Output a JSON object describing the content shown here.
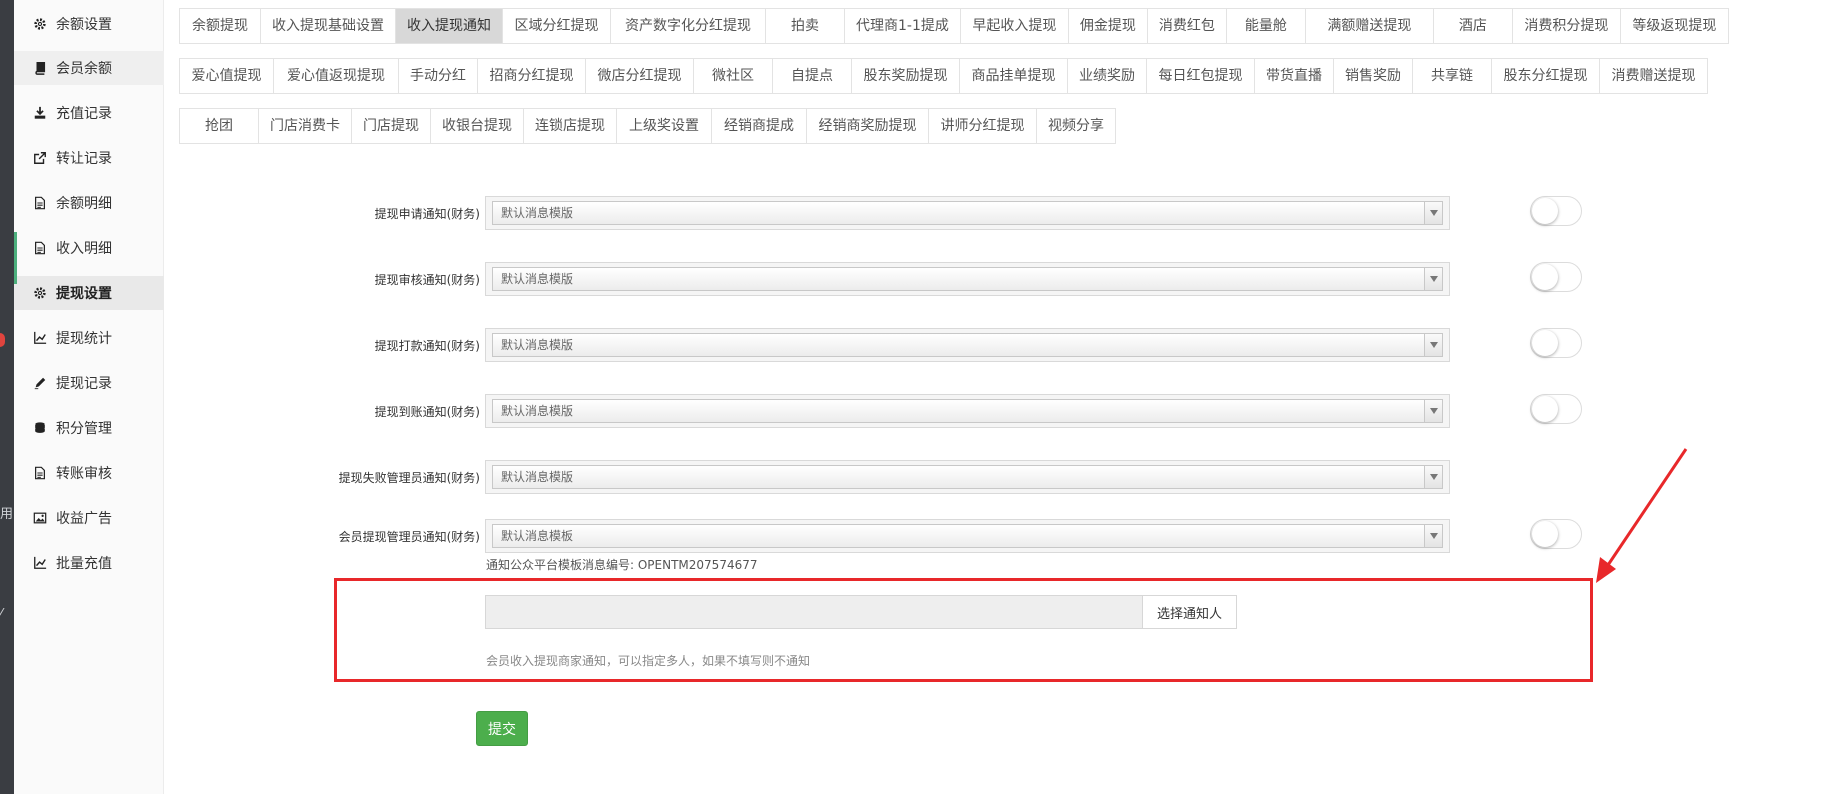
{
  "sidebar": {
    "items": [
      {
        "label": "余额设置",
        "icon": "gear-icon"
      },
      {
        "label": "会员余额",
        "icon": "book-icon"
      },
      {
        "label": "充值记录",
        "icon": "download-icon"
      },
      {
        "label": "转让记录",
        "icon": "external-link-icon"
      },
      {
        "label": "余额明细",
        "icon": "document-icon"
      },
      {
        "label": "收入明细",
        "icon": "document-icon"
      },
      {
        "label": "提现设置",
        "icon": "gear-icon"
      },
      {
        "label": "提现统计",
        "icon": "line-chart-icon"
      },
      {
        "label": "提现记录",
        "icon": "pencil-icon"
      },
      {
        "label": "积分管理",
        "icon": "database-icon"
      },
      {
        "label": "转账审核",
        "icon": "document-icon"
      },
      {
        "label": "收益广告",
        "icon": "image-icon"
      },
      {
        "label": "批量充值",
        "icon": "line-chart-icon"
      }
    ],
    "active_index": 6
  },
  "left_strip": {
    "glyph_1": "用",
    "glyph_2": "⁄"
  },
  "tabs": {
    "row1": [
      "余额提现",
      "收入提现基础设置",
      "收入提现通知",
      "区域分红提现",
      "资产数字化分红提现",
      "拍卖",
      "代理商1-1提成",
      "早起收入提现",
      "佣金提现",
      "消费红包",
      "能量舱",
      "满额赠送提现",
      "酒店",
      "消费积分提现",
      "等级返现提现"
    ],
    "row2": [
      "爱心值提现",
      "爱心值返现提现",
      "手动分红",
      "招商分红提现",
      "微店分红提现",
      "微社区",
      "自提点",
      "股东奖励提现",
      "商品挂单提现",
      "业绩奖励",
      "每日红包提现",
      "带货直播",
      "销售奖励",
      "共享链",
      "股东分红提现",
      "消费赠送提现"
    ],
    "row3": [
      "抢团",
      "门店消费卡",
      "门店提现",
      "收银台提现",
      "连锁店提现",
      "上级奖设置",
      "经销商提成",
      "经销商奖励提现",
      "讲师分红提现",
      "视频分享"
    ],
    "active": "收入提现通知"
  },
  "form": {
    "rows": [
      {
        "label": "提现申请通知(财务)",
        "select_value": "默认消息模版",
        "has_toggle": true,
        "toggle_on": false
      },
      {
        "label": "提现审核通知(财务)",
        "select_value": "默认消息模版",
        "has_toggle": true,
        "toggle_on": false
      },
      {
        "label": "提现打款通知(财务)",
        "select_value": "默认消息模版",
        "has_toggle": true,
        "toggle_on": false
      },
      {
        "label": "提现到账通知(财务)",
        "select_value": "默认消息模版",
        "has_toggle": true,
        "toggle_on": false
      },
      {
        "label": "提现失败管理员通知(财务)",
        "select_value": "默认消息模版",
        "has_toggle": false,
        "toggle_on": false
      },
      {
        "label": "会员提现管理员通知(财务)",
        "select_value": "默认消息模板",
        "has_toggle": true,
        "toggle_on": false
      }
    ],
    "template_hint": "通知公众平台模板消息编号: OPENTM207574677",
    "notify": {
      "input_value": "",
      "button_label": "选择通知人",
      "help_text": "会员收入提现商家通知，可以指定多人，如果不填写则不通知"
    },
    "submit_label": "提交"
  },
  "colors": {
    "highlight": "#e8282a",
    "submit": "#4cae4c",
    "active_tab": "#d8d8d8",
    "accent_bar": "#4caf7d"
  }
}
